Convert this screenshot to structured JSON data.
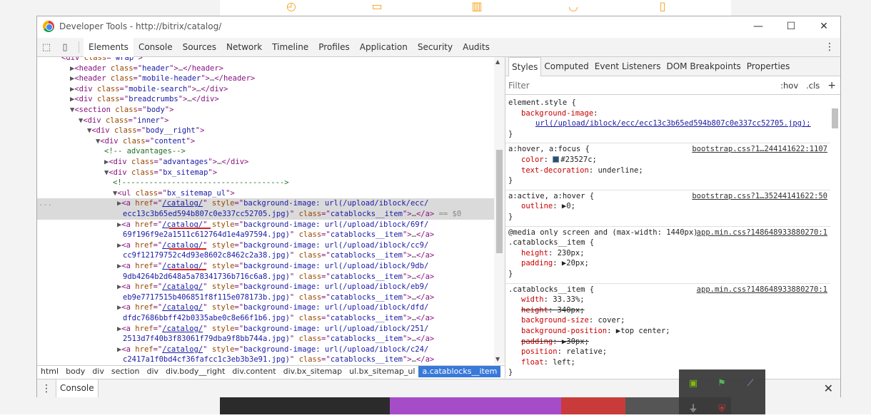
{
  "window": {
    "title": "Developer Tools - http://bitrix/catalog/",
    "minimize": "—",
    "maximize": "☐",
    "close": "✕"
  },
  "toolbar": {
    "tabs": [
      "Elements",
      "Console",
      "Sources",
      "Network",
      "Timeline",
      "Profiles",
      "Application",
      "Security",
      "Audits"
    ],
    "active": "Elements",
    "more": "⋮"
  },
  "dom_lines": [
    {
      "indent": 3,
      "tri": "",
      "html": "<div class=\"wrap\">",
      "parts": [
        [
          "tag",
          "<div "
        ],
        [
          "at",
          "class"
        ],
        [
          "tag",
          "=\""
        ],
        [
          "av",
          "wrap"
        ],
        [
          "tag",
          "\">"
        ]
      ]
    },
    {
      "indent": 4,
      "tri": "▶",
      "parts": [
        [
          "tag",
          "<header "
        ],
        [
          "at",
          "class"
        ],
        [
          "tag",
          "=\""
        ],
        [
          "av",
          "header"
        ],
        [
          "tag",
          "\">"
        ],
        [
          "tr",
          "…"
        ],
        [
          "tag",
          "</header>"
        ]
      ]
    },
    {
      "indent": 4,
      "tri": "▶",
      "parts": [
        [
          "tag",
          "<header "
        ],
        [
          "at",
          "class"
        ],
        [
          "tag",
          "=\""
        ],
        [
          "av",
          "mobile-header"
        ],
        [
          "tag",
          "\">"
        ],
        [
          "tr",
          "…"
        ],
        [
          "tag",
          "</header>"
        ]
      ]
    },
    {
      "indent": 4,
      "tri": "▶",
      "parts": [
        [
          "tag",
          "<div "
        ],
        [
          "at",
          "class"
        ],
        [
          "tag",
          "=\""
        ],
        [
          "av",
          "mobile-search"
        ],
        [
          "tag",
          "\">"
        ],
        [
          "tr",
          "…"
        ],
        [
          "tag",
          "</div>"
        ]
      ]
    },
    {
      "indent": 4,
      "tri": "▶",
      "parts": [
        [
          "tag",
          "<div "
        ],
        [
          "at",
          "class"
        ],
        [
          "tag",
          "=\""
        ],
        [
          "av",
          "breadcrumbs"
        ],
        [
          "tag",
          "\">"
        ],
        [
          "tr",
          "…"
        ],
        [
          "tag",
          "</div>"
        ]
      ]
    },
    {
      "indent": 4,
      "tri": "▼",
      "parts": [
        [
          "tag",
          "<section "
        ],
        [
          "at",
          "class"
        ],
        [
          "tag",
          "=\""
        ],
        [
          "av",
          "body"
        ],
        [
          "tag",
          "\">"
        ]
      ]
    },
    {
      "indent": 5,
      "tri": "▼",
      "parts": [
        [
          "tag",
          "<div "
        ],
        [
          "at",
          "class"
        ],
        [
          "tag",
          "=\""
        ],
        [
          "av",
          "inner"
        ],
        [
          "tag",
          "\">"
        ]
      ]
    },
    {
      "indent": 6,
      "tri": "▼",
      "parts": [
        [
          "tag",
          "<div "
        ],
        [
          "at",
          "class"
        ],
        [
          "tag",
          "=\""
        ],
        [
          "av",
          "body__right"
        ],
        [
          "tag",
          "\">"
        ]
      ]
    },
    {
      "indent": 7,
      "tri": "▼",
      "parts": [
        [
          "tag",
          "<div "
        ],
        [
          "at",
          "class"
        ],
        [
          "tag",
          "=\""
        ],
        [
          "av",
          "content"
        ],
        [
          "tag",
          "\">"
        ]
      ]
    },
    {
      "indent": 8,
      "tri": "",
      "parts": [
        [
          "cm",
          "<!-- advantages-->"
        ]
      ]
    },
    {
      "indent": 8,
      "tri": "▶",
      "parts": [
        [
          "tag",
          "<div "
        ],
        [
          "at",
          "class"
        ],
        [
          "tag",
          "=\""
        ],
        [
          "av",
          "advantages"
        ],
        [
          "tag",
          "\">"
        ],
        [
          "tr",
          "…"
        ],
        [
          "tag",
          "</div>"
        ]
      ]
    },
    {
      "indent": 8,
      "tri": "▼",
      "parts": [
        [
          "tag",
          "<div "
        ],
        [
          "at",
          "class"
        ],
        [
          "tag",
          "=\""
        ],
        [
          "av",
          "bx_sitemap"
        ],
        [
          "tag",
          "\">"
        ]
      ]
    },
    {
      "indent": 9,
      "tri": "",
      "parts": [
        [
          "cm",
          "<!------------------------------------>"
        ]
      ]
    },
    {
      "indent": 9,
      "tri": "▼",
      "parts": [
        [
          "tag",
          "<ul "
        ],
        [
          "at",
          "class"
        ],
        [
          "tag",
          "=\""
        ],
        [
          "av",
          "bx_sitemap_ul"
        ],
        [
          "tag",
          "\">"
        ]
      ]
    }
  ],
  "items": [
    {
      "line1": "/upload/iblock/ecc/",
      "line2": "ecc13c3b65ed594b807c0e337cc52705.jpg",
      "selected": true,
      "suffix": " == $0"
    },
    {
      "line1": "/upload/iblock/69f/",
      "line2": "69f196f9e2a1511c612764d1e4a97594.jpg",
      "selected": false,
      "suffix": ""
    },
    {
      "line1": "/upload/iblock/cc9/",
      "line2": "cc9f12179752c4d93e8602c8462c2a38.jpg",
      "selected": false,
      "suffix": ""
    },
    {
      "line1": "/upload/iblock/9db/",
      "line2": "9db4264b2d648a5a78341736b716c6a8.jpg",
      "selected": false,
      "suffix": ""
    },
    {
      "line1": "/upload/iblock/eb9/",
      "line2": "eb9e7717515b406851f8f115e078173b.jpg",
      "selected": false,
      "suffix": ""
    },
    {
      "line1": "/upload/iblock/dfd/",
      "line2": "dfdc7686bbff42b0335abe0c8e66f1b6.jpg",
      "selected": false,
      "suffix": ""
    },
    {
      "line1": "/upload/iblock/251/",
      "line2": "2513d7f40b3f83061f79dba9f8bb744a.jpg",
      "selected": false,
      "suffix": ""
    },
    {
      "line1": "/upload/iblock/c24/",
      "line2": "c2417a1f0bd4cf36fafcc1c3eb3b3e91.jpg",
      "selected": false,
      "suffix": ""
    }
  ],
  "item_tokens": {
    "open": "<a ",
    "href": "href",
    "href_val": "/catalog/",
    "style": "style",
    "style_prefix": "background-image: url(",
    "close_url": ")",
    "class": "class",
    "class_val": "catablocks__item",
    "ellipsis": "…",
    "end": "</a>",
    "dots": "..."
  },
  "breadcrumbs": [
    "html",
    "body",
    "div",
    "section",
    "div",
    "div.body__right",
    "div.content",
    "div.bx_sitemap",
    "ul.bx_sitemap_ul",
    "a.catablocks__item"
  ],
  "styles_tabs": [
    "Styles",
    "Computed",
    "Event Listeners",
    "DOM Breakpoints",
    "Properties"
  ],
  "filter": {
    "placeholder": "Filter",
    "hov": ":hov",
    "cls": ".cls",
    "add": "+"
  },
  "rules": [
    {
      "selector": "element.style {",
      "source": "",
      "props": [
        {
          "name": "background-image",
          "value": "",
          "strike": false
        },
        {
          "name": "",
          "value": "url(/upload/iblock/ecc/ecc13c3b65ed594b807c0e337cc52705.jpg);",
          "strike": false,
          "link": true
        }
      ]
    },
    {
      "selector": "a:hover, a:focus {",
      "source": "bootstrap.css?1…244141622:1107",
      "props": [
        {
          "name": "color",
          "value": "#23527c;",
          "strike": false,
          "swatch": true
        },
        {
          "name": "text-decoration",
          "value": "underline;",
          "strike": false
        }
      ]
    },
    {
      "selector": "a:active, a:hover {",
      "source": "bootstrap.css?1…35244141622:50",
      "props": [
        {
          "name": "outline",
          "value": "▶0;",
          "strike": false
        }
      ]
    },
    {
      "selector": "@media only screen and (max-width: 1440px)",
      "selector2": ".catablocks__item {",
      "source": "app.min.css?148648933880270:1",
      "props": [
        {
          "name": "height",
          "value": "230px;",
          "strike": false
        },
        {
          "name": "padding",
          "value": "▶20px;",
          "strike": false
        }
      ]
    },
    {
      "selector": ".catablocks__item {",
      "source": "app.min.css?148648933880270:1",
      "props": [
        {
          "name": "width",
          "value": "33.33%;",
          "strike": false
        },
        {
          "name": "height",
          "value": "340px;",
          "strike": true
        },
        {
          "name": "background-size",
          "value": "cover;",
          "strike": false
        },
        {
          "name": "background-position",
          "value": "▶top center;",
          "strike": false
        },
        {
          "name": "padding",
          "value": "▶30px;",
          "strike": true
        },
        {
          "name": "position",
          "value": "relative;",
          "strike": false
        },
        {
          "name": "float",
          "value": "left;",
          "strike": false
        }
      ]
    }
  ],
  "rule_close": "}",
  "drawer": {
    "tab": "Console",
    "close": "✕",
    "dots": "⋮"
  },
  "colors": {
    "accent": "#3879d9",
    "tag": "#881280",
    "attr": "#994500",
    "value": "#1a1aa6",
    "prop": "#c80000",
    "bg_brand": "#f6a21c"
  }
}
